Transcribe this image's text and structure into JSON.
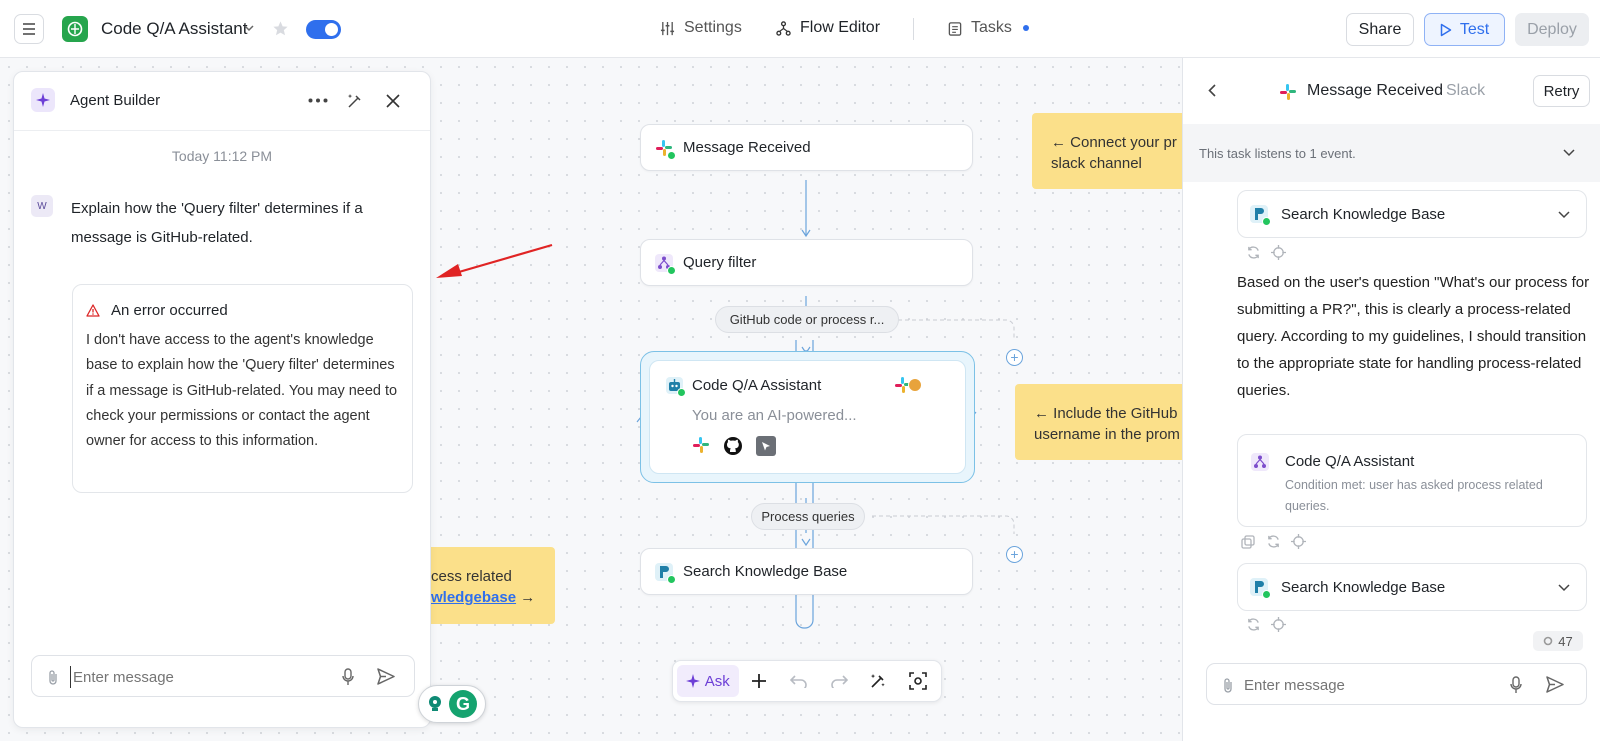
{
  "header": {
    "app_title": "Code Q/A Assistant",
    "nav": {
      "settings": "Settings",
      "flow_editor": "Flow Editor",
      "tasks": "Tasks"
    },
    "share": "Share",
    "test": "Test",
    "deploy": "Deploy"
  },
  "builder": {
    "title": "Agent Builder",
    "timestamp": "Today 11:12 PM",
    "avatar_letter": "W",
    "user_message": "Explain how the 'Query filter' determines if a message is GitHub-related.",
    "error_title": "An error occurred",
    "error_body": "I don't have access to the agent's knowledge base to explain how the 'Query filter' determines if a message is GitHub-related. You may need to check your permissions or contact the agent owner for access to this information.",
    "input_placeholder": "Enter message"
  },
  "flow": {
    "node_message": "Message Received",
    "node_query": "Query filter",
    "edge1": "GitHub code or process r...",
    "node_code_title": "Code Q/A Assistant",
    "node_code_sub": "You are an AI-powered...",
    "edge2": "Process queries",
    "node_search": "Search Knowledge Base",
    "sticky1_line1": "← Connect your pr",
    "sticky1_line2": "slack channel",
    "sticky2_line1": "← Include the GitHub",
    "sticky2_line2": "username in the prom",
    "sticky3_line1": "cess related",
    "sticky3_link": "wledgebase",
    "sticky3_arrow": "→",
    "ask": "Ask"
  },
  "task": {
    "title": "Message Received",
    "source": "Slack",
    "retry": "Retry",
    "listens": "This task listens to 1 event.",
    "step1": "Search Knowledge Base",
    "response": "Based on the user's question \"What's our process for submitting a PR?\", this is clearly a process-related query. According to my guidelines, I should transition to the appropriate state for handling process-related queries.",
    "step2_title": "Code Q/A Assistant",
    "step2_sub": "Condition met: user has asked process related queries.",
    "step3": "Search Knowledge Base",
    "count": "47",
    "input_placeholder": "Enter message"
  },
  "colors": {
    "accent": "#2f6fed",
    "sticky": "#fbe08a",
    "success": "#22c55e",
    "error": "#dc2626"
  }
}
